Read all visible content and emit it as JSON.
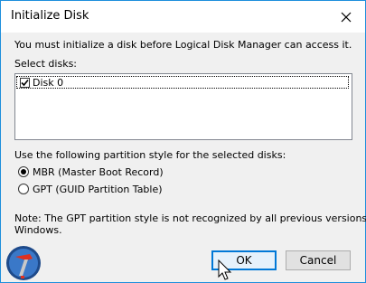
{
  "dialog": {
    "title": "Initialize Disk",
    "intro": "You must initialize a disk before Logical Disk Manager can access it.",
    "select_label": "Select disks:",
    "disks": [
      {
        "label": "Disk 0",
        "checked": true
      }
    ],
    "partition_label": "Use the following partition style for the selected disks:",
    "options": [
      {
        "label": "MBR (Master Boot Record)",
        "selected": true
      },
      {
        "label": "GPT (GUID Partition Table)",
        "selected": false
      }
    ],
    "note_line1": "Note: The GPT partition style is not recognized by all previous versions of",
    "note_line2": "Windows.",
    "ok_label": "OK",
    "cancel_label": "Cancel"
  },
  "icons": {
    "close": "close-icon",
    "logo": "hammer-logo-icon",
    "cursor": "mouse-pointer-icon"
  },
  "colors": {
    "window_border": "#1e8fdc",
    "dialog_bg": "#f0f0f0",
    "default_button_border": "#0078d7"
  }
}
